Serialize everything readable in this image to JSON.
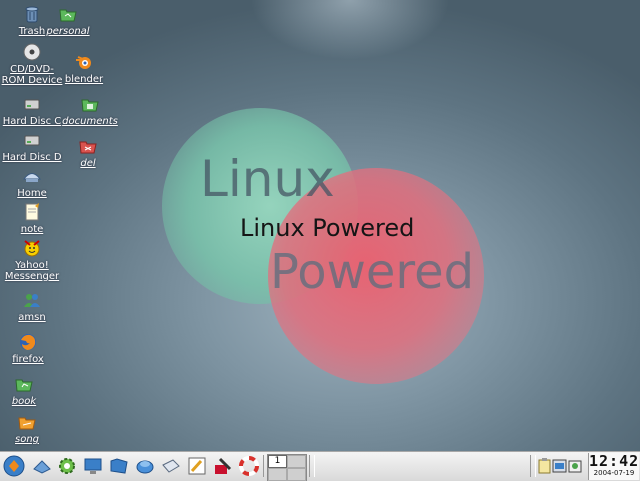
{
  "wallpaper": {
    "word_linux": "Linux",
    "word_powered": "Powered",
    "main_text": "Linux Powered"
  },
  "desktop_icons": {
    "trash": "Trash",
    "personal": "personal",
    "cdrom": "CD/DVD-\nROM Device",
    "blender": "blender",
    "hdc": "Hard Disc C",
    "documents": "documents",
    "hdd": "Hard Disc D",
    "del": "del",
    "home": "Home",
    "note": "note",
    "yahoo": "Yahoo!\nMessenger",
    "amsn": "amsn",
    "firefox": "firefox",
    "book": "book",
    "song": "song"
  },
  "taskbar": {
    "pager_desktop": "1",
    "clock_time": "12:42",
    "clock_date": "2004-07-19"
  },
  "colors": {
    "desktop_bg": "#7f95a3",
    "circle_green": "#96d7be",
    "circle_red": "#eb5f6e",
    "taskbar": "#e6e6e6"
  }
}
